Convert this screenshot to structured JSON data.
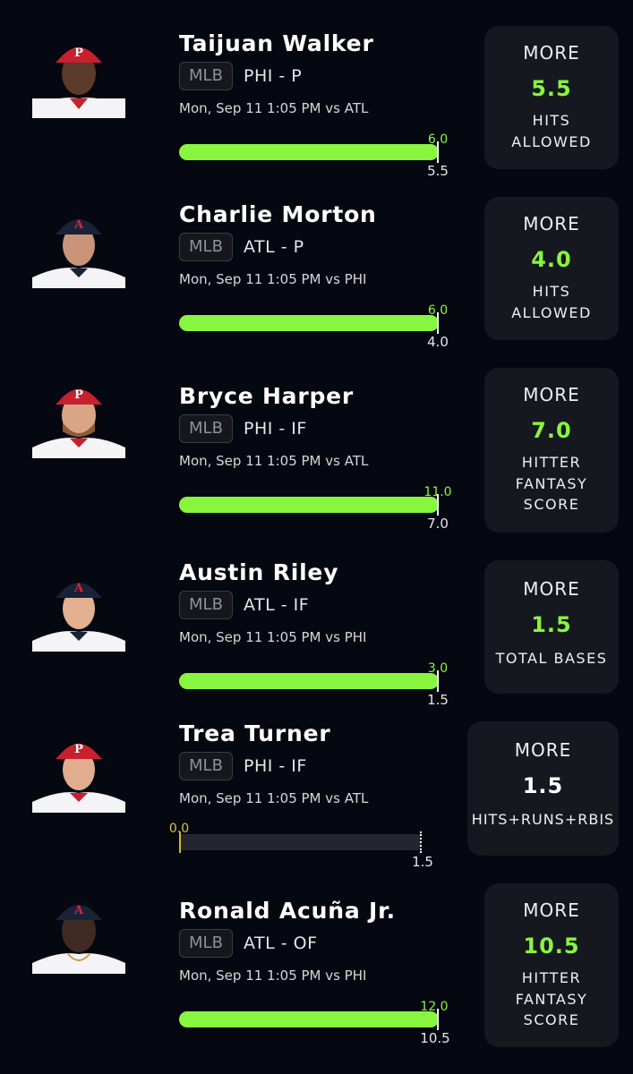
{
  "picks": [
    {
      "name": "Taijuan Walker",
      "league": "MLB",
      "team_position": "PHI - P",
      "game": "Mon, Sep 11 1:05 PM  vs ATL",
      "actual": "6.0",
      "line": "5.5",
      "progress": 1.0,
      "card": {
        "direction": "MORE",
        "value": "5.5",
        "stat": [
          "HITS",
          "ALLOWED"
        ]
      },
      "cap_color": "#c8202f",
      "logo": "P"
    },
    {
      "name": "Charlie Morton",
      "league": "MLB",
      "team_position": "ATL - P",
      "game": "Mon, Sep 11 1:05 PM  vs PHI",
      "actual": "6.0",
      "line": "4.0",
      "progress": 1.0,
      "card": {
        "direction": "MORE",
        "value": "4.0",
        "stat": [
          "HITS",
          "ALLOWED"
        ]
      },
      "cap_color": "#1a2238",
      "logo": "A"
    },
    {
      "name": "Bryce Harper",
      "league": "MLB",
      "team_position": "PHI - IF",
      "game": "Mon, Sep 11 1:05 PM  vs ATL",
      "actual": "11.0",
      "line": "7.0",
      "progress": 1.0,
      "card": {
        "direction": "MORE",
        "value": "7.0",
        "stat": [
          "HITTER",
          "FANTASY",
          "SCORE"
        ]
      },
      "cap_color": "#c8202f",
      "logo": "P"
    },
    {
      "name": "Austin Riley",
      "league": "MLB",
      "team_position": "ATL - IF",
      "game": "Mon, Sep 11 1:05 PM  vs PHI",
      "actual": "3.0",
      "line": "1.5",
      "progress": 1.0,
      "card": {
        "direction": "MORE",
        "value": "1.5",
        "stat": [
          "TOTAL BASES"
        ]
      },
      "cap_color": "#1a2238",
      "logo": "A"
    },
    {
      "name": "Trea Turner",
      "league": "MLB",
      "team_position": "PHI - IF",
      "game": "Mon, Sep 11 1:05 PM  vs ATL",
      "actual": "0.0",
      "line": "1.5",
      "progress": 0.0,
      "card": {
        "direction": "MORE",
        "value": "1.5",
        "stat": [
          "HITS+RUNS+RBIS"
        ]
      },
      "cap_color": "#c8202f",
      "logo": "P"
    },
    {
      "name": "Ronald Acuña Jr.",
      "league": "MLB",
      "team_position": "ATL - OF",
      "game": "Mon, Sep 11 1:05 PM  vs PHI",
      "actual": "12.0",
      "line": "10.5",
      "progress": 1.0,
      "card": {
        "direction": "MORE",
        "value": "10.5",
        "stat": [
          "HITTER",
          "FANTASY",
          "SCORE"
        ]
      },
      "cap_color": "#1a2238",
      "logo": "A"
    }
  ]
}
